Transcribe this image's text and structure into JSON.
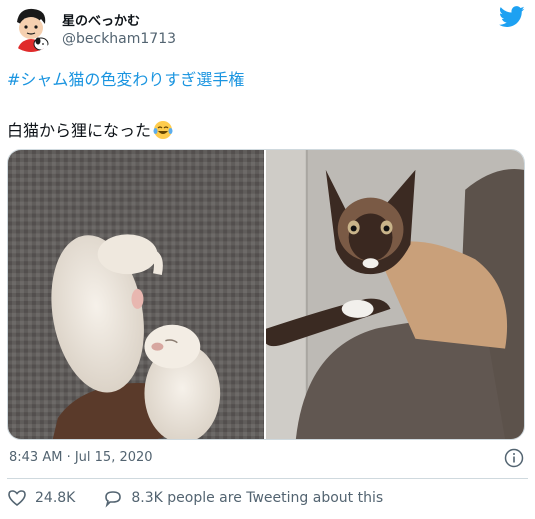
{
  "tweet": {
    "display_name": "星のべっかむ",
    "handle": "@beckham1713",
    "hashtag": "#シャム猫の色変わりすぎ選手権",
    "text": "白猫から狸になった",
    "emoji": "face-with-tears-of-joy",
    "timestamp": "8:43 AM · Jul 15, 2020",
    "like_count": "24.8K",
    "tweeting_text": "8.3K people are Tweeting about this"
  },
  "colors": {
    "link": "#1b95e0",
    "twitter_blue": "#1da1f2",
    "secondary_text": "#536471",
    "border": "#cfd9de"
  },
  "icons": [
    "cartoon-avatar",
    "twitter-bird-icon",
    "info-icon",
    "heart-icon",
    "speech-bubble-icon"
  ]
}
